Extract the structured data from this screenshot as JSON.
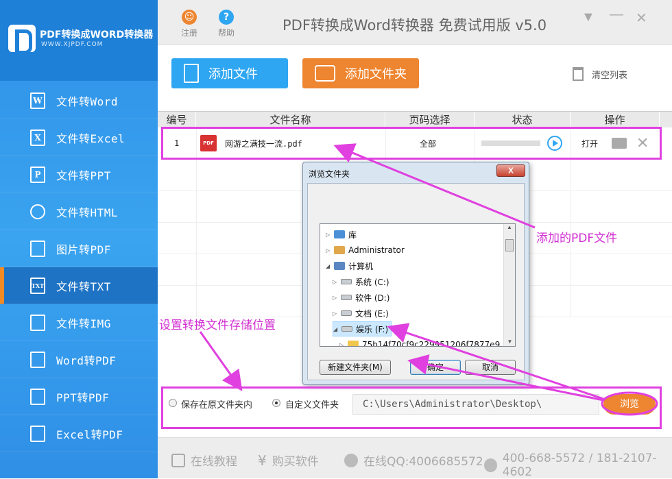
{
  "brand": {
    "name": "PDF转换成WORD转换器",
    "url": "WWW.XJPDF.COM"
  },
  "sidebar": {
    "items": [
      {
        "label": "文件转Word",
        "icon": "word-icon",
        "glyph": "W",
        "active": false
      },
      {
        "label": "文件转Excel",
        "icon": "excel-icon",
        "glyph": "X",
        "active": false
      },
      {
        "label": "文件转PPT",
        "icon": "ppt-icon",
        "glyph": "P",
        "active": false
      },
      {
        "label": "文件转HTML",
        "icon": "globe-icon",
        "glyph": "",
        "active": false
      },
      {
        "label": "图片转PDF",
        "icon": "pdf-icon",
        "glyph": "",
        "active": false
      },
      {
        "label": "文件转TXT",
        "icon": "txt-icon",
        "glyph": "TXT",
        "active": true
      },
      {
        "label": "文件转IMG",
        "icon": "image-icon",
        "glyph": "",
        "active": false
      },
      {
        "label": "Word转PDF",
        "icon": "pdf-icon",
        "glyph": "",
        "active": false
      },
      {
        "label": "PPT转PDF",
        "icon": "pdf-icon",
        "glyph": "",
        "active": false
      },
      {
        "label": "Excel转PDF",
        "icon": "pdf-icon",
        "glyph": "",
        "active": false
      }
    ]
  },
  "topbar": {
    "register_label": "注册",
    "help_label": "帮助",
    "title": "PDF转换成Word转换器 免费试用版 v5.0"
  },
  "toolbar": {
    "add_file_label": "添加文件",
    "add_folder_label": "添加文件夹",
    "clear_label": "清空列表"
  },
  "table": {
    "headers": [
      "编号",
      "文件名称",
      "页码选择",
      "状态",
      "操作"
    ],
    "rows": [
      {
        "index": "1",
        "name": "网游之满技一流.pdf",
        "pages": "全部",
        "action": "打开"
      }
    ]
  },
  "output": {
    "option_original": "保存在原文件夹内",
    "option_custom": "自定义文件夹",
    "selected": "custom",
    "path": "C:\\Users\\Administrator\\Desktop\\",
    "browse_label": "浏览"
  },
  "footer": {
    "tutorial": "在线教程",
    "buy": "购买软件",
    "qq": "在线QQ:4006685572",
    "phone": "400-668-5572 / 181-2107-4602"
  },
  "dialog": {
    "title": "浏览文件夹",
    "close": "X",
    "tree": [
      {
        "label": "库",
        "level": 0,
        "expanded": false,
        "icon": "lib"
      },
      {
        "label": "Administrator",
        "level": 0,
        "expanded": false,
        "icon": "user"
      },
      {
        "label": "计算机",
        "level": 0,
        "expanded": true,
        "icon": "pc"
      },
      {
        "label": "系统 (C:)",
        "level": 1,
        "expanded": false,
        "icon": "drive"
      },
      {
        "label": "软件 (D:)",
        "level": 1,
        "expanded": false,
        "icon": "drive"
      },
      {
        "label": "文档 (E:)",
        "level": 1,
        "expanded": false,
        "icon": "drive"
      },
      {
        "label": "娱乐 (F:)",
        "level": 1,
        "expanded": true,
        "icon": "drive",
        "selected": true
      },
      {
        "label": "75b14f70cf9c229951206f7877e9",
        "level": 2,
        "expanded": false,
        "icon": "folder"
      }
    ],
    "new_folder_label": "新建文件夹(M)",
    "ok_label": "确定",
    "cancel_label": "取消"
  },
  "annotations": {
    "added_pdf": "添加的PDF文件",
    "storage_location": "设置转换文件存储位置"
  },
  "colors": {
    "sidebar_blue": "#2f8fe6",
    "accent_orange": "#ee8530",
    "button_blue": "#2fa6f2",
    "annotation_magenta": "#e040e0"
  }
}
